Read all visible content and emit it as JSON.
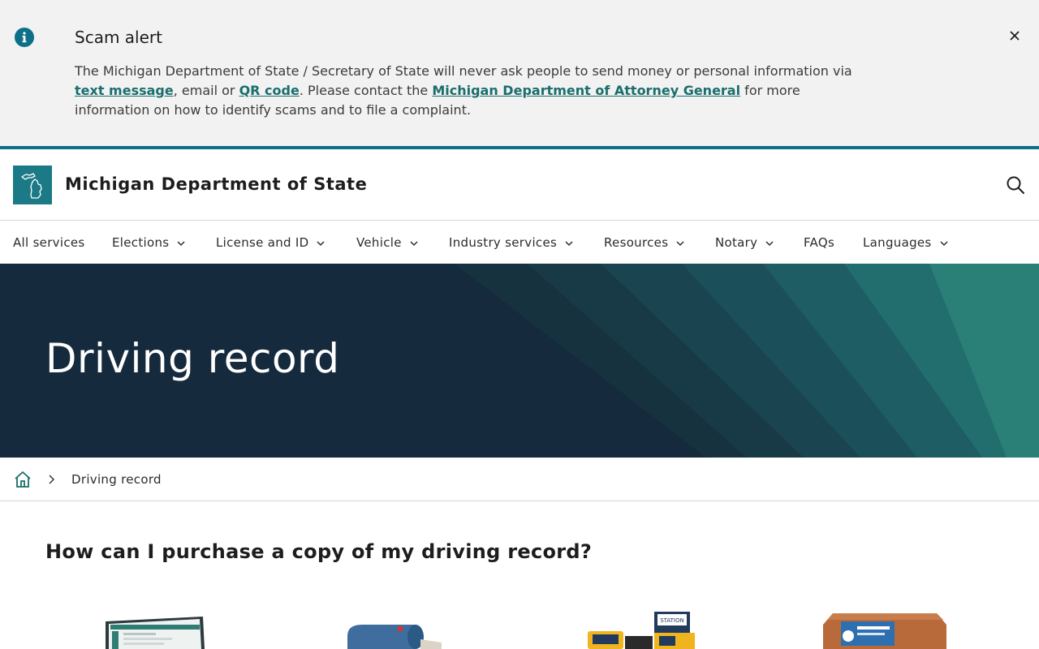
{
  "alert": {
    "title": "Scam alert",
    "text_1": "The Michigan Department of State / Secretary of State will never ask people to send money or personal information via ",
    "link_text_message": "text message",
    "text_2": ", email or ",
    "link_qr_code": "QR code",
    "text_3": ". Please contact the ",
    "link_attorney_general": "Michigan Department of Attorney General",
    "text_4": " for more information on how to identify scams and to file a complaint.",
    "close_symbol": "×",
    "info_icon": "info-circle-icon"
  },
  "header": {
    "site_title": "Michigan Department of State",
    "logo_icon": "michigan-state-outline-icon",
    "search_icon": "search-icon"
  },
  "nav": {
    "items": [
      {
        "label": "All services",
        "has_dropdown": false
      },
      {
        "label": "Elections",
        "has_dropdown": true
      },
      {
        "label": "License and ID",
        "has_dropdown": true
      },
      {
        "label": "Vehicle",
        "has_dropdown": true
      },
      {
        "label": "Industry services",
        "has_dropdown": true
      },
      {
        "label": "Resources",
        "has_dropdown": true
      },
      {
        "label": "Notary",
        "has_dropdown": true
      },
      {
        "label": "FAQs",
        "has_dropdown": false
      },
      {
        "label": "Languages",
        "has_dropdown": true
      }
    ]
  },
  "hero": {
    "title": "Driving record"
  },
  "breadcrumb": {
    "home_icon": "home-icon",
    "current": "Driving record"
  },
  "main": {
    "heading": "How can I purchase a copy of my driving record?",
    "cards": [
      {
        "image": "online-computer-screen"
      },
      {
        "image": "mailbox"
      },
      {
        "image": "self-service-station-kiosk"
      },
      {
        "image": "secretary-of-state-office-building"
      }
    ]
  },
  "colors": {
    "accent": "#0d6f88",
    "link": "#1a6e6c",
    "hero_bg": "#152a3d",
    "logo_bg": "#1c7a86",
    "alert_bg": "#f2f2f2"
  }
}
